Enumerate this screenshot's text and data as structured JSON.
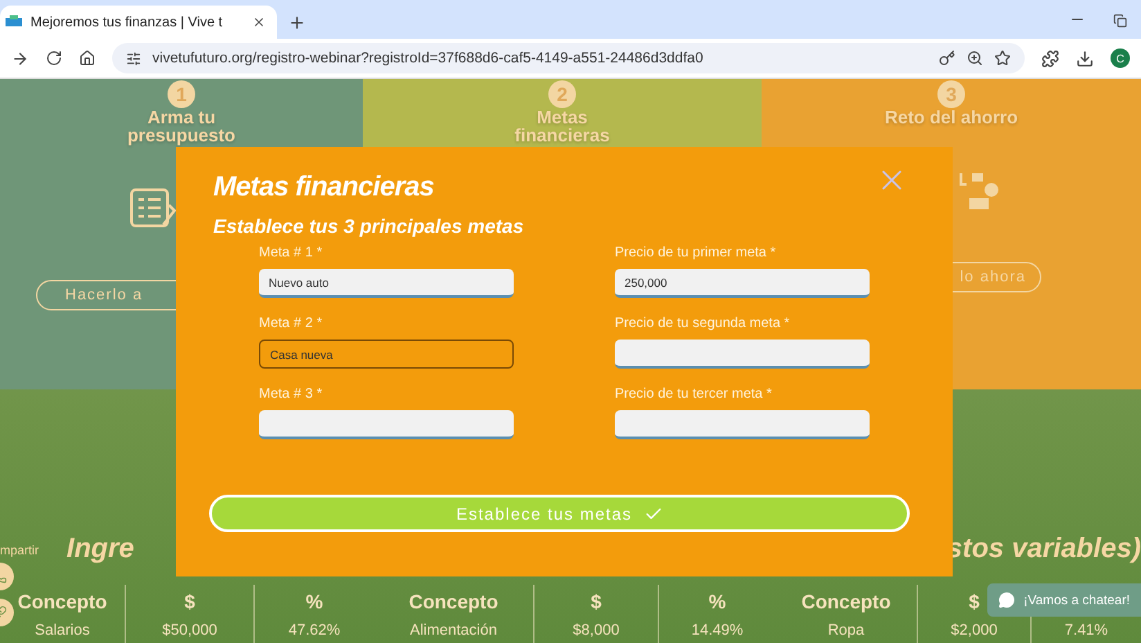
{
  "browser": {
    "tab_title": "Mejoremos tus finanzas | Vive t",
    "url": "vivetufuturo.org/registro-webinar?registroId=37f688d6-caf5-4149-a551-24486d3ddfa0",
    "avatar": "C"
  },
  "steps": [
    {
      "number": "1",
      "title_lines": [
        "Arma tu",
        "presupuesto"
      ],
      "button": "Hacerlo a"
    },
    {
      "number": "2",
      "title_lines": [
        "Metas",
        "financieras"
      ]
    },
    {
      "number": "3",
      "title_lines": [
        "Reto del ahorro"
      ],
      "button": "lo ahora"
    }
  ],
  "share_label": "mpartir",
  "section_heading": {
    "left": "Ingre",
    "right": "stos variables)"
  },
  "table": {
    "columns": [
      "Concepto",
      "$",
      "%",
      "Concepto",
      "$",
      "%",
      "Concepto",
      "$"
    ],
    "rows": [
      [
        "Salarios",
        "$50,000",
        "47.62%",
        "Alimentación",
        "$8,000",
        "14.49%",
        "Ropa",
        "$2,000",
        "7.41%"
      ]
    ]
  },
  "chat": {
    "label": "¡Vamos a chatear!"
  },
  "modal": {
    "title": "Metas financieras",
    "subtitle": "Establece tus 3 principales metas",
    "fields": [
      {
        "label": "Meta # 1 *",
        "value": "Nuevo auto",
        "focused": false
      },
      {
        "label": "Precio de tu primer meta *",
        "value": "250,000",
        "focused": false
      },
      {
        "label": "Meta # 2 *",
        "value": "Casa nueva",
        "focused": true
      },
      {
        "label": "Precio de tu segunda meta *",
        "focused": false
      },
      {
        "label": "Meta # 3 *",
        "focused": false
      },
      {
        "label": "Precio de tu tercer meta *",
        "focused": false
      }
    ],
    "submit": "Establece tus metas"
  }
}
